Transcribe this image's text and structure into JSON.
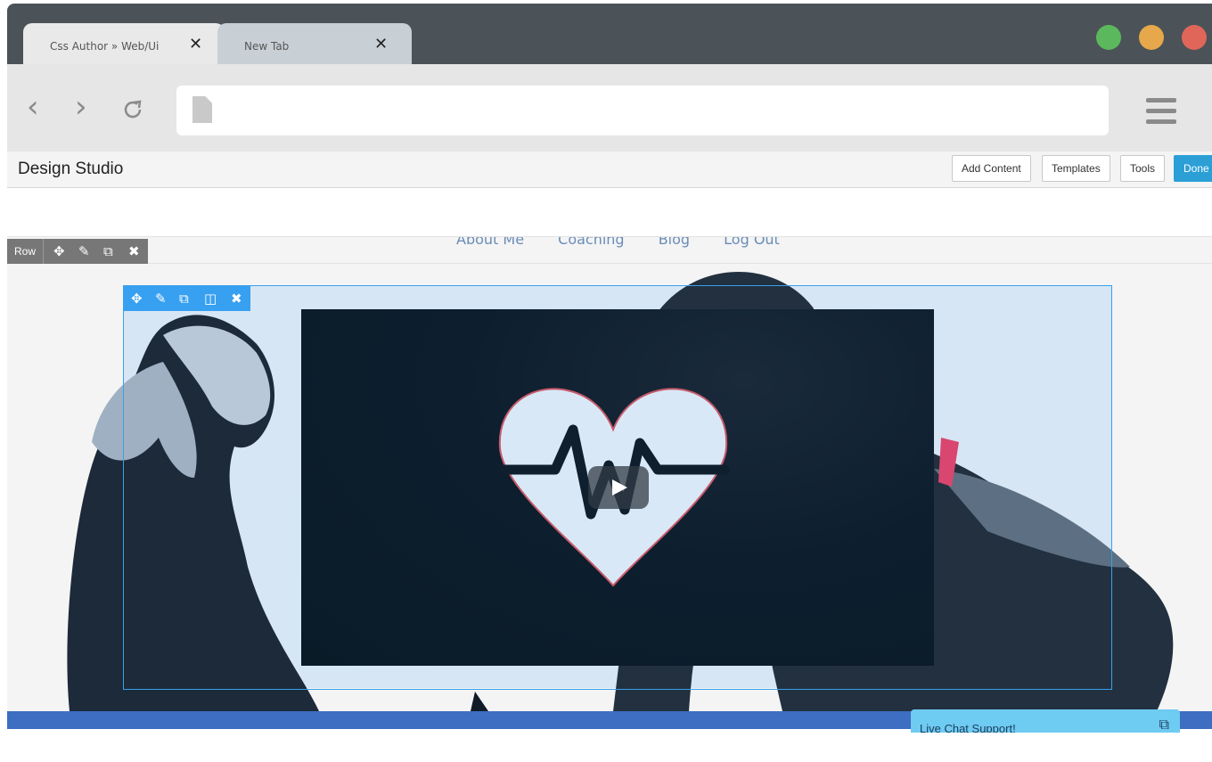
{
  "browser": {
    "tabs": [
      {
        "title": "Css Author » Web/Ui",
        "close": "✕"
      },
      {
        "title": "New Tab",
        "close": "✕"
      }
    ],
    "window_colors": {
      "green": "#5cb85c",
      "yellow": "#e6a84a",
      "red": "#e0665a"
    }
  },
  "studio": {
    "title": "Design Studio",
    "buttons": {
      "add_content": "Add Content",
      "templates": "Templates",
      "tools": "Tools",
      "done": "Done"
    }
  },
  "site_nav": [
    "About Me",
    "Coaching",
    "Blog",
    "Log Out"
  ],
  "row_toolbar": {
    "label": "Row"
  },
  "chat": {
    "label": "Live Chat Support!"
  },
  "colors": {
    "accent": "#2b9fd6",
    "selection": "#38a0f0",
    "footer": "#3e6ec2",
    "chat": "#6ecbf2"
  }
}
